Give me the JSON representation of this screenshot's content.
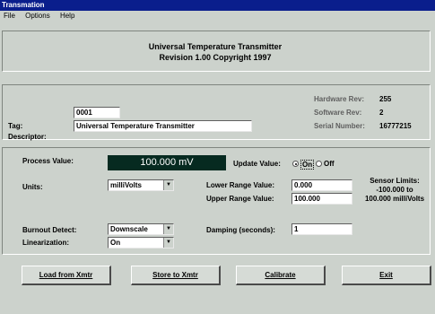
{
  "window": {
    "title": "Transmation"
  },
  "menu": [
    {
      "label": "File"
    },
    {
      "label": "Options"
    },
    {
      "label": "Help"
    }
  ],
  "header": {
    "line1": "Universal Temperature Transmitter",
    "line2": "Revision 1.00  Copyright 1997"
  },
  "device": {
    "tag_label": "Tag:",
    "tag_value": "0001",
    "descriptor_label": "Descriptor:",
    "descriptor_value": "Universal Temperature Transmitter",
    "hardware_rev_label": "Hardware Rev:",
    "hardware_rev_value": "255",
    "software_rev_label": "Software Rev:",
    "software_rev_value": "2",
    "serial_label": "Serial Number:",
    "serial_value": "16777215"
  },
  "config": {
    "process_value_label": "Process Value:",
    "process_value": "100.000 mV",
    "update_value_label": "Update Value:",
    "update_on_label": "On",
    "update_off_label": "Off",
    "units_label": "Units:",
    "units_value": "milliVolts",
    "lower_range_label": "Lower Range Value:",
    "lower_range_value": "0.000",
    "upper_range_label": "Upper Range Value:",
    "upper_range_value": "100.000",
    "sensor_limits_title": "Sensor Limits:",
    "sensor_limits_line1": "-100.000 to",
    "sensor_limits_line2": "100.000 milliVolts",
    "burnout_label": "Burnout Detect:",
    "burnout_value": "Downscale",
    "linearization_label": "Linearization:",
    "linearization_value": "On",
    "damping_label": "Damping (seconds):",
    "damping_value": "1"
  },
  "buttons": {
    "load": "Load from Xmtr",
    "store": "Store to Xmtr",
    "calibrate": "Calibrate",
    "exit": "Exit"
  }
}
